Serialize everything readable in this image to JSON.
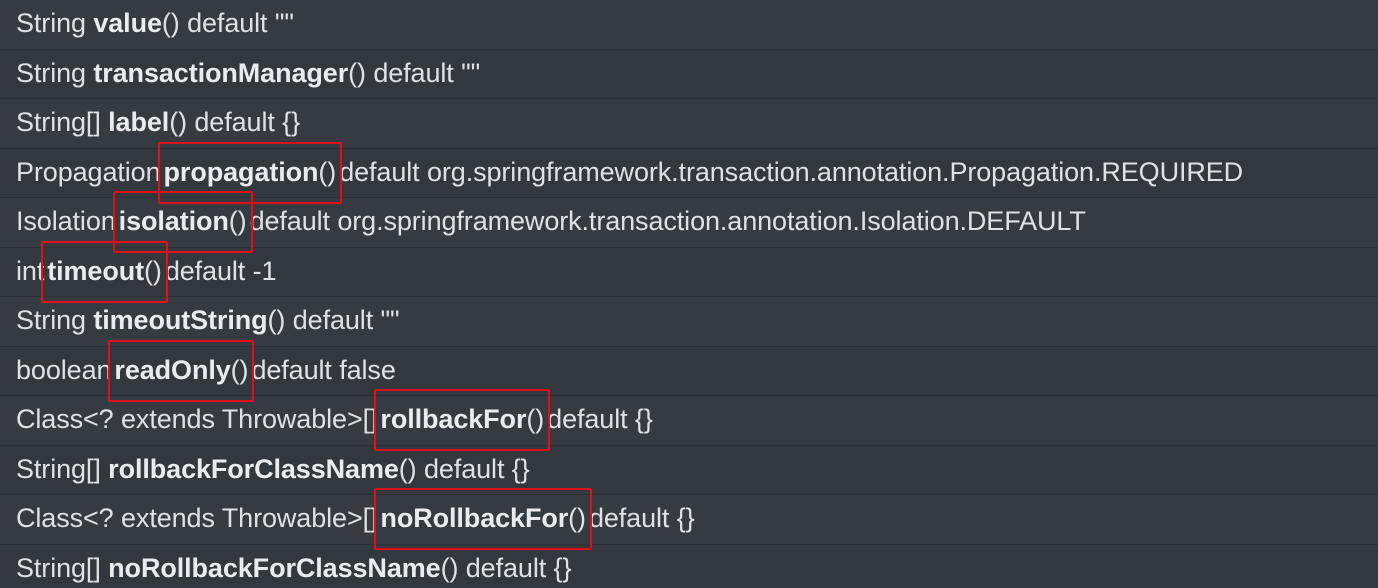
{
  "highlight_color": "#e0101b",
  "rows": [
    {
      "type": "String",
      "name": "value",
      "parens": "()",
      "rest": "default \"\"",
      "highlighted": false
    },
    {
      "type": "String",
      "name": "transactionManager",
      "parens": "()",
      "rest": "default \"\"",
      "highlighted": false
    },
    {
      "type": "String[]",
      "name": "label",
      "parens": "()",
      "rest": "default {}",
      "highlighted": false
    },
    {
      "type": "Propagation",
      "name": "propagation",
      "parens": "()",
      "rest": "default org.springframework.transaction.annotation.Propagation.REQUIRED",
      "highlighted": true
    },
    {
      "type": "Isolation",
      "name": "isolation",
      "parens": "()",
      "rest": "default org.springframework.transaction.annotation.Isolation.DEFAULT",
      "highlighted": true
    },
    {
      "type": "int",
      "name": "timeout",
      "parens": "()",
      "rest": "default -1",
      "highlighted": true
    },
    {
      "type": "String",
      "name": "timeoutString",
      "parens": "()",
      "rest": "default \"\"",
      "highlighted": false
    },
    {
      "type": "boolean",
      "name": "readOnly",
      "parens": "()",
      "rest": "default false",
      "highlighted": true
    },
    {
      "type": "Class<? extends Throwable>[]",
      "name": "rollbackFor",
      "parens": "()",
      "rest": "default {}",
      "highlighted": true
    },
    {
      "type": "String[]",
      "name": "rollbackForClassName",
      "parens": "()",
      "rest": "default {}",
      "highlighted": false
    },
    {
      "type": "Class<? extends Throwable>[]",
      "name": "noRollbackFor",
      "parens": "()",
      "rest": "default {}",
      "highlighted": true
    },
    {
      "type": "String[]",
      "name": "noRollbackForClassName",
      "parens": "()",
      "rest": "default {}",
      "highlighted": false
    }
  ]
}
